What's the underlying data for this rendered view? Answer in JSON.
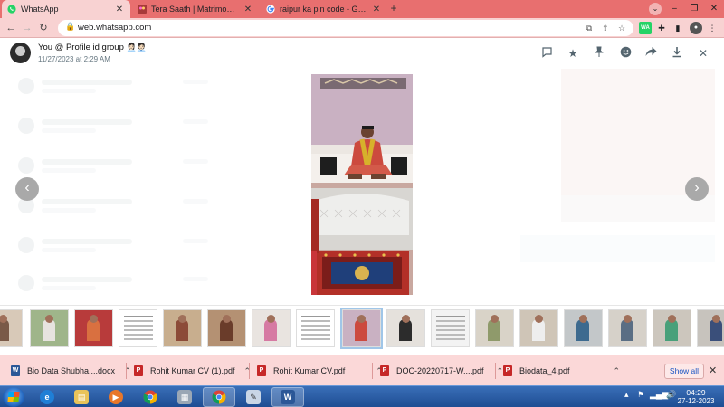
{
  "browser": {
    "tabs": [
      {
        "title": "WhatsApp",
        "active": true
      },
      {
        "title": "Tera Saath | Matrimonial Site | Ba",
        "active": false
      },
      {
        "title": "raipur ka pin code - Google Search",
        "active": false
      }
    ],
    "address": "web.whatsapp.com"
  },
  "viewer": {
    "sender": "You @ Profile id group",
    "timestamp": "11/27/2023 at 2:29 AM",
    "header_icons": [
      "chat-icon",
      "star-icon",
      "pin-icon",
      "emoji-icon",
      "forward-icon",
      "download-icon",
      "close-icon"
    ]
  },
  "downloads": {
    "items": [
      {
        "name": "Bio  Data Shubha....docx",
        "type": "word"
      },
      {
        "name": "Rohit Kumar CV (1).pdf",
        "type": "pdf"
      },
      {
        "name": "Rohit Kumar CV.pdf",
        "type": "pdf"
      },
      {
        "name": "DOC-20220717-W....pdf",
        "type": "pdf"
      },
      {
        "name": "Biodata_4.pdf",
        "type": "pdf"
      }
    ],
    "show_all": "Show all"
  },
  "taskbar": {
    "time": "04:29",
    "date": "27-12-2023"
  }
}
